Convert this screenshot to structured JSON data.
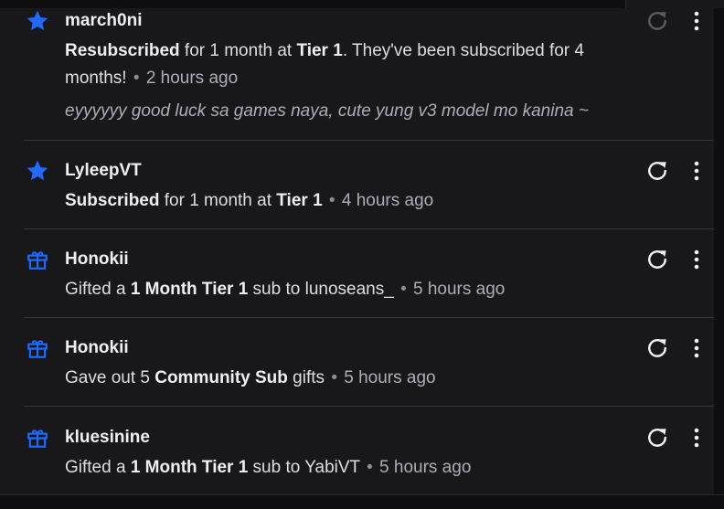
{
  "colors": {
    "background": "#18181b",
    "accent_blue": "#1f69ff",
    "divider": "#35353b",
    "muted_text": "#adadb8"
  },
  "separator": "•",
  "events": [
    {
      "icon": "star-icon",
      "username": "march0ni",
      "parts": [
        "Resubscribed",
        " for 1 month at ",
        "Tier 1",
        ". They've been subscribed for 4 months!"
      ],
      "time": "2 hours ago",
      "message": "eyyyyyy good luck sa games naya, cute yung v3 model mo kanina ~",
      "replay_disabled": true
    },
    {
      "icon": "star-icon",
      "username": "LyleepVT",
      "parts": [
        "Subscribed",
        " for 1 month at ",
        "Tier 1",
        ""
      ],
      "time": "4 hours ago",
      "replay_disabled": false
    },
    {
      "icon": "gift-icon",
      "username": "Honokii",
      "parts": [
        "Gifted a ",
        "1 Month Tier 1",
        " sub to lunoseans_",
        ""
      ],
      "time": "5 hours ago",
      "replay_disabled": false
    },
    {
      "icon": "gift-icon",
      "username": "Honokii",
      "parts": [
        "Gave out 5 ",
        "Community Sub",
        " gifts",
        ""
      ],
      "time": "5 hours ago",
      "replay_disabled": false
    },
    {
      "icon": "gift-icon",
      "username": "kluesinine",
      "parts": [
        "Gifted a ",
        "1 Month Tier 1",
        " sub to YabiVT",
        ""
      ],
      "time": "5 hours ago",
      "replay_disabled": false
    }
  ]
}
